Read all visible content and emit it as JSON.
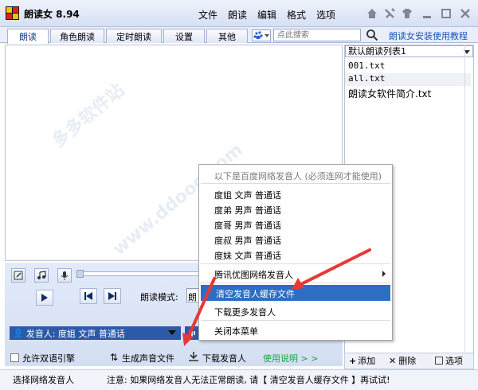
{
  "app": {
    "title": "朗读女 8.94"
  },
  "menubar": {
    "items": [
      "文件",
      "朗读",
      "编辑",
      "格式",
      "选项"
    ]
  },
  "tabs": [
    "朗读",
    "角色朗读",
    "定时朗读",
    "设置",
    "其他"
  ],
  "search": {
    "placeholder": "点此搜索"
  },
  "tutorial_link": "朗读女安装使用教程",
  "playlist": {
    "selected": "默认朗读列表1",
    "items": [
      "001.txt",
      "all.txt",
      "朗读女软件简介.txt"
    ],
    "footer": {
      "add": "添加",
      "delete": "删除",
      "options": "选项"
    }
  },
  "controls": {
    "read_mode_label": "朗读模式:",
    "read_mode_value": "朗",
    "speaker": "发音人: 度姐 文声 普通话",
    "allow_dual": "允许双语引擎",
    "generate_audio": "生成声音文件",
    "download_speaker": "下载发音人",
    "usage_link": "使用说明 > >"
  },
  "status": {
    "left": "选择网络发音人",
    "notice": "注意: 如果网络发音人无法正常朗读, 请【 清空发音人缓存文件 】再试试!"
  },
  "context_menu": {
    "header": "以下是百度网络发音人 (必须连网才能使用)",
    "voices": [
      "度姐 文声 普通话",
      "度弟 男声 普通话",
      "度哥 男声 普通话",
      "度叔 男声 普通话",
      "度妹 文声 普通话"
    ],
    "tengxun": "腾讯优图网络发音人",
    "clear_cache": "清空发音人缓存文件",
    "download_more": "下载更多发音人",
    "close": "关闭本菜单"
  },
  "colors": {
    "accent": "#2c5aa8",
    "highlight": "#2d6ec4",
    "arrow": "#e53935",
    "link": "#1653b6"
  }
}
